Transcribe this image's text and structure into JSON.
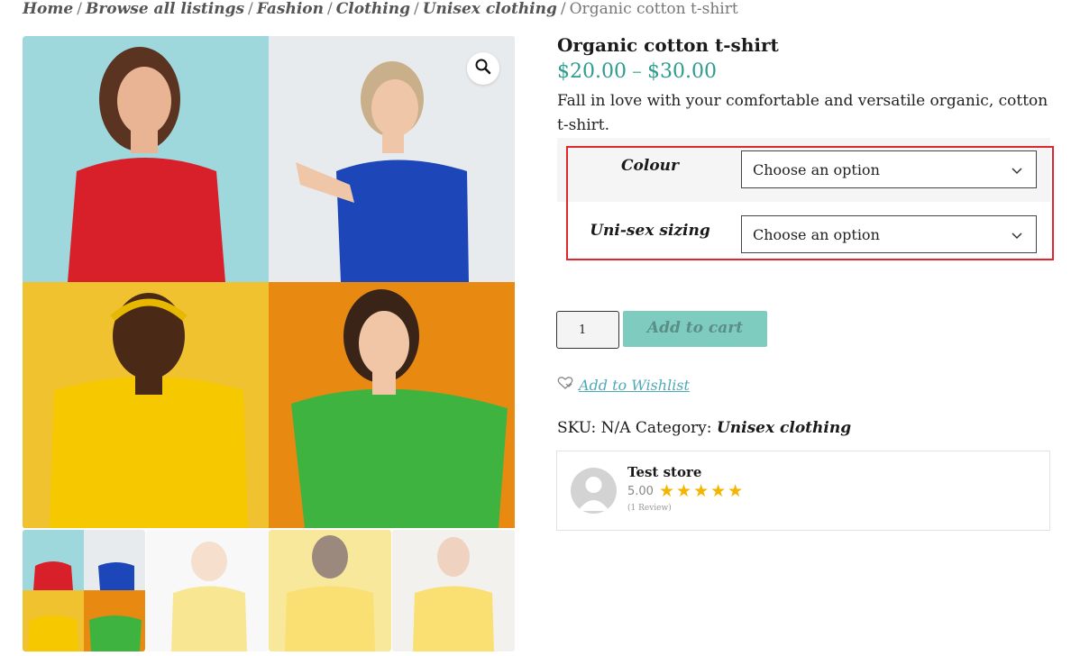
{
  "breadcrumb": {
    "items": [
      "Home",
      "Browse all listings",
      "Fashion",
      "Clothing",
      "Unisex clothing"
    ],
    "current": "Organic cotton t-shirt",
    "separator": "/"
  },
  "product": {
    "title": "Organic cotton t-shirt",
    "price_min": "$20.00",
    "price_sep": "–",
    "price_max": "$30.00",
    "description": "Fall in love with your comfortable and versatile organic, cotton t-shirt."
  },
  "variations": [
    {
      "label": "Colour",
      "selected": "Choose an option"
    },
    {
      "label": "Uni-sex sizing",
      "selected": "Choose an option"
    }
  ],
  "cart": {
    "quantity": "1",
    "add_label": "Add to cart"
  },
  "wishlist": {
    "label": "Add to Wishlist"
  },
  "meta": {
    "sku_label": "SKU:",
    "sku_value": "N/A",
    "category_label": "Category:",
    "category_value": "Unisex clothing"
  },
  "vendor": {
    "name": "Test store",
    "rating": "5.00",
    "stars": "★★★★★",
    "reviews": "(1 Review)"
  },
  "icons": {
    "zoom": "magnifier-icon",
    "chevron": "chevron-down-icon",
    "wishlist": "heart-icon"
  },
  "colors": {
    "accent": "#2e9c8f",
    "cart_button": "#7ecbbf",
    "highlight": "#e0262e",
    "star": "#f4b400"
  }
}
